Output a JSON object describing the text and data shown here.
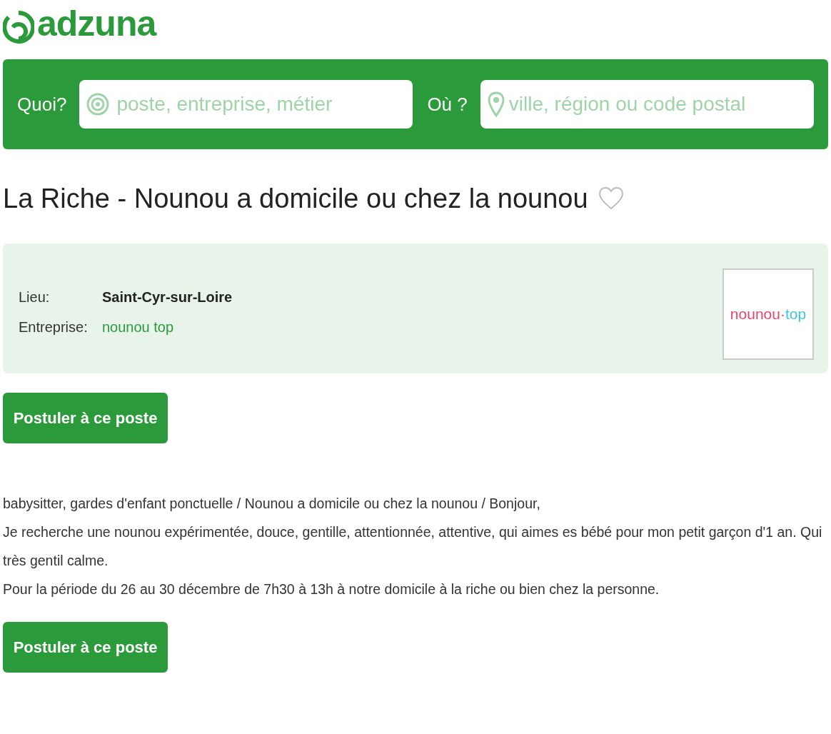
{
  "logo": {
    "text": "adzuna"
  },
  "search": {
    "what_label": "Quoi?",
    "what_placeholder": "poste, entreprise, métier",
    "where_label": "Où ?",
    "where_placeholder": "ville, région ou code postal"
  },
  "job": {
    "title": "La Riche - Nounou a domicile ou chez la nounou",
    "favorite": false,
    "details": [
      {
        "label": "Lieu:",
        "value": "Saint-Cyr-sur-Loire",
        "kind": "text"
      },
      {
        "label": "Entreprise:",
        "value": "nounou top",
        "kind": "link"
      }
    ],
    "company_logo": {
      "part_1": "nounou",
      "separator": "·",
      "part_2": "top"
    },
    "apply_button": "Postuler à ce poste",
    "description": [
      "babysitter, gardes d'enfant ponctuelle / Nounou a domicile ou chez la nounou / Bonjour,",
      "Je recherche une nounou expérimentée, douce, gentille, attentionnée, attentive, qui aimes es bébé pour mon petit garçon d'1 an. Qui très gentil calme.",
      "Pour la période du 26 au 30 décembre de 7h30 à 13h à notre domicile à la riche ou bien chez la personne."
    ],
    "apply_button_bottom": "Postuler à ce poste"
  }
}
